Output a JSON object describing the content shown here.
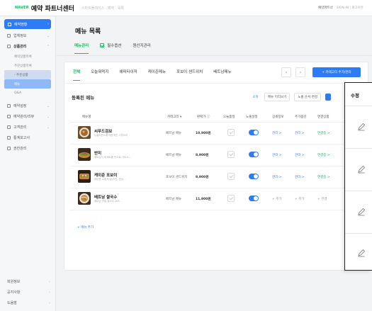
{
  "topbar": {
    "logo": "NAVER",
    "brand": "예약 파트너센터",
    "crumbs": "스마트플레이스 · 예약 · 목록",
    "user": "예약파트너",
    "links": "SIGN-IN | 로그아웃"
  },
  "sidebar": {
    "items": [
      {
        "label": "예약현황",
        "active": true
      },
      {
        "label": "업체정보"
      },
      {
        "label": "상품관리",
        "bold": true
      }
    ],
    "subs": [
      "예약상품목록",
      "주문상품목록",
      "- 주문상품",
      "메뉴",
      "Q&A"
    ],
    "more": [
      "예약설정",
      "예약관리/리뷰",
      "고객관리",
      "통계보고서",
      "권한관리"
    ],
    "bottom": [
      "회원정보",
      "공지사항",
      "도움말"
    ]
  },
  "header": {
    "title": "메뉴 목록",
    "tabs": [
      "메뉴관리",
      "필수옵션",
      "원산지관리"
    ]
  },
  "card": {
    "tabs": [
      "전체",
      "오늘뭐먹지",
      "에피타이저",
      "케이준메뉴",
      "포보이 샌드위치",
      "베트남메뉴"
    ],
    "prev": "‹",
    "next": "›",
    "add_category": "+ 카테고리 추가/관리",
    "section_title": "등록된 메뉴",
    "count": "4개",
    "tool1": "메뉴 미리보기",
    "tool2": "노출 순서 변경",
    "columns": [
      "메뉴명",
      "카테고리 ▾",
      "판매가 ⓘ",
      "오늘품절",
      "노출설정",
      "상세정보",
      "추가옵션",
      "연결상품"
    ],
    "rows": [
      {
        "name": "씨푸드검보",
        "desc": "뉴올리언스풍 대표적인 스튜요리",
        "category": "베트남 메뉴",
        "price": "10,900원",
        "detail": "관리 >",
        "option": "관리 >",
        "linked": "연결중 >"
      },
      {
        "name": "반미",
        "desc": "베트남식 바게트를 반으로 가르고...",
        "category": "베트남 메뉴",
        "price": "8,900원",
        "detail": "관리 >",
        "option": "관리 >",
        "linked": "연결중 >"
      },
      {
        "name": "케이준 포보이",
        "desc": "케이준 쉬림프/굴/치킨, 양상...",
        "category": "포보이 샌드위치",
        "price": "9,900원",
        "detail": "관리 >",
        "option": "관리 >",
        "linked": "연결중 >"
      },
      {
        "name": "베트남 쌀국수",
        "desc": "베트남 전통 쌀국수 요리...",
        "category": "베트남 메뉴",
        "price": "11,900원",
        "detail": "+ 추가",
        "option": "+ 추가",
        "linked": "+ 연결"
      }
    ],
    "add_menu": "+ 메뉴 추가"
  },
  "edit_panel": {
    "title": "수정"
  },
  "colors": {
    "accent": "#2d7cf6",
    "brand": "#03c75a"
  }
}
